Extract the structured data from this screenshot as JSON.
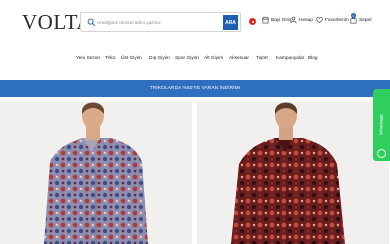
{
  "brand": {
    "logo_text": "VOLTAJ"
  },
  "search": {
    "placeholder": "Aradığınız ürünün adını yazınız",
    "button_label": "ARA"
  },
  "header_links": {
    "dealer_login": "Bayi Giriş",
    "account": "Hesap",
    "favorites": "Favorilerim",
    "cart": "Sepet",
    "cart_count": "0"
  },
  "nav": {
    "items": [
      "Yeni Sezon",
      "Triko",
      "Üst Giyim",
      "Dış Giyim",
      "Spor Giyim",
      "Alt Giyim",
      "Aksesuar",
      "Tişört",
      "Kampanyalar",
      "Blog"
    ]
  },
  "promo": {
    "text": "TRİKOLARDA %50'YE VARAN İNDİRİM!"
  },
  "whatsapp": {
    "label": "Whatsapp"
  },
  "colors": {
    "accent": "#1f5fb3",
    "promo_bg": "#2f6fc0",
    "whatsapp": "#2ecf5c",
    "flag": "#e2231a"
  },
  "icons": [
    "search-icon",
    "flag-icon",
    "store-icon",
    "user-icon",
    "heart-icon",
    "bag-icon",
    "whatsapp-icon"
  ]
}
